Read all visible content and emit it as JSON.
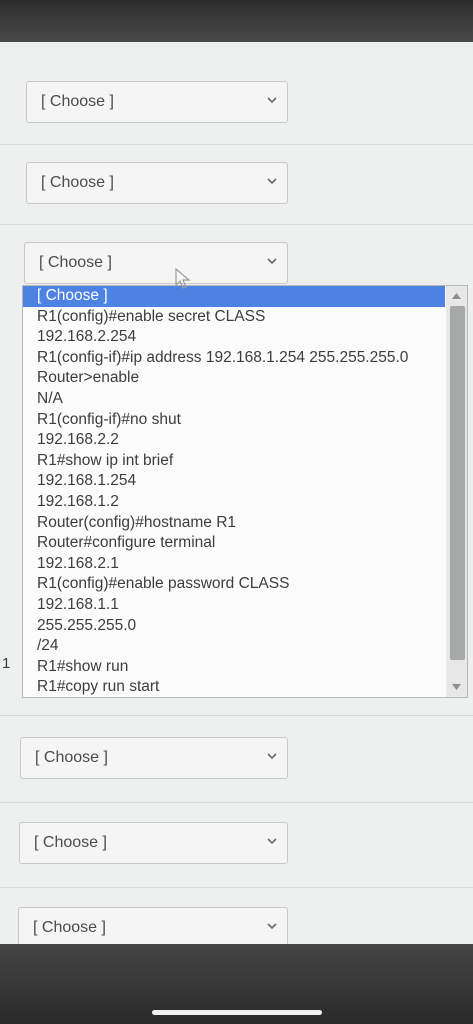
{
  "dropdowns": [
    {
      "value": "[ Choose ]"
    },
    {
      "value": "[ Choose ]"
    },
    {
      "value": "[ Choose ]"
    },
    {
      "value": "[ Choose ]"
    },
    {
      "value": "[ Choose ]"
    },
    {
      "value": "[ Choose ]"
    }
  ],
  "open_dropdown": {
    "options": [
      "[ Choose ]",
      "R1(config)#enable secret CLASS",
      "192.168.2.254",
      "R1(config-if)#ip address 192.168.1.254 255.255.255.0",
      "Router>enable",
      "N/A",
      "R1(config-if)#no shut",
      "192.168.2.2",
      "R1#show ip int brief",
      "192.168.1.254",
      "192.168.1.2",
      "Router(config)#hostname R1",
      "Router#configure terminal",
      "192.168.2.1",
      "R1(config)#enable password CLASS",
      "192.168.1.1",
      "255.255.255.0",
      "/24",
      "R1#show run",
      "R1#copy run start"
    ],
    "selected_index": 0
  },
  "row_number": "1",
  "colors": {
    "highlight": "#4d82e3",
    "page_bg": "#eef0ef"
  }
}
